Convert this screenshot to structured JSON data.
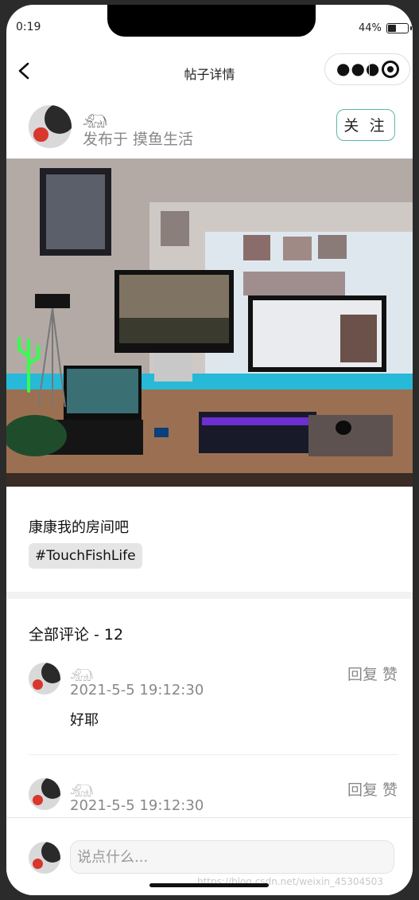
{
  "status_bar": {
    "time": "0:19",
    "battery_text": "44%",
    "battery_level": 0.44
  },
  "nav": {
    "title": "帖子详情"
  },
  "author": {
    "name": "𓃰",
    "subtitle": "发布于 摸鱼生活",
    "follow_label": "关 注"
  },
  "post": {
    "caption": "康康我的房间吧",
    "tag": "#TouchFishLife"
  },
  "comments": {
    "header": "全部评论 - 12",
    "items": [
      {
        "name": "𓃰",
        "time": "2021-5-5 19:12:30",
        "reply": "回复",
        "like": "赞",
        "text": "好耶"
      },
      {
        "name": "𓃰",
        "time": "2021-5-5 19:12:30",
        "reply": "回复",
        "like": "赞",
        "text": ""
      }
    ]
  },
  "input": {
    "placeholder": "说点什么..."
  },
  "watermark": "https://blog.csdn.net/weixin_45304503",
  "colors": {
    "follow_border": "#5ab8a8",
    "secondary_text": "#888888"
  }
}
